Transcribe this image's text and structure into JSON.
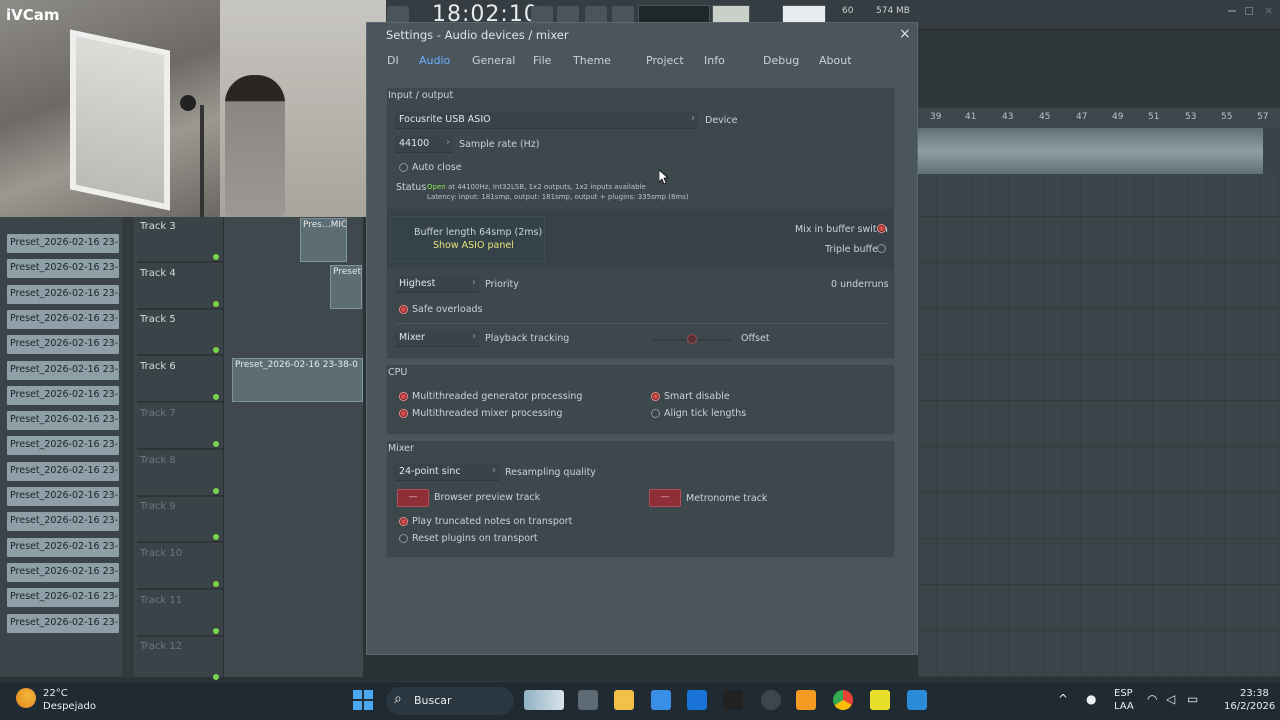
{
  "topbar": {
    "time": "18:02:10",
    "tempo_readout": "60",
    "memory": "574 MB"
  },
  "camera": {
    "label": "iVCam"
  },
  "playlist_left": {
    "presets": [
      "Preset_2026-02-16 23-21...",
      "Preset_2026-02-16 23-22...",
      "Preset_2026-02-16 23-22...",
      "Preset_2026-02-16 23-22...",
      "Preset_2026-02-16 23-22...",
      "Preset_2026-02-16 23-22...",
      "Preset_2026-02-16 23-23...",
      "Preset_2026-02-16 23-23...",
      "Preset_2026-02-16 23-23...",
      "Preset_2026-02-16 23-24...",
      "Preset_2026-02-16 23-24...",
      "Preset_2026-02-16 23-24...",
      "Preset_2026-02-16 23-28...",
      "Preset_2026-02-16 23-29...",
      "Preset_2026-02-16 23-30...",
      "Preset_2026-02-16 23-30..."
    ],
    "tracks": [
      "Track 3",
      "Track 4",
      "Track 5",
      "Track 6",
      "Track 7",
      "Track 8",
      "Track 9",
      "Track 10",
      "Track 11",
      "Track 12"
    ],
    "clips": {
      "c1": "Pres...MIC",
      "c2": "Preset",
      "c3": "Preset_2026-02-16 23-38-0"
    }
  },
  "ruler": {
    "marks": [
      "39",
      "41",
      "43",
      "45",
      "47",
      "49",
      "51",
      "53",
      "55",
      "57"
    ]
  },
  "settings": {
    "title": "Settings - Audio devices / mixer",
    "close": "×",
    "tabs": [
      "DI",
      "Audio",
      "General",
      "File",
      "Theme",
      "Project",
      "Info",
      "Debug",
      "About"
    ],
    "active_tab": "Audio",
    "io": {
      "section": "Input / output",
      "device_value": "Focusrite USB ASIO",
      "device_label": "Device",
      "rate_value": "44100",
      "rate_label": "Sample rate (Hz)",
      "auto_close": "Auto close",
      "status_label": "Status",
      "status_open": "Open",
      "status_line1": "at 44100Hz, Int32LSB, 1x2 outputs, 1x2 inputs available",
      "status_line2": "Latency: input: 181smp, output: 181smp, output + plugins: 335smp (8ms)",
      "buffer_length": "Buffer length 64smp (2ms)",
      "show_asio": "Show ASIO panel",
      "mix_buffer": "Mix in buffer switch",
      "triple_buffer": "Triple buffer",
      "priority_value": "Highest",
      "priority_label": "Priority",
      "underruns": "0 underruns",
      "safe_overloads": "Safe overloads",
      "tracking_value": "Mixer",
      "tracking_label": "Playback tracking",
      "offset": "Offset"
    },
    "cpu": {
      "section": "CPU",
      "multi_gen": "Multithreaded generator processing",
      "multi_mix": "Multithreaded mixer processing",
      "smart_disable": "Smart disable",
      "align_tick": "Align tick lengths"
    },
    "mixer": {
      "section": "Mixer",
      "resample_value": "24-point sinc",
      "resample_label": "Resampling quality",
      "btn_dash": "—",
      "browser_preview": "Browser preview track",
      "metronome": "Metronome track",
      "play_truncated": "Play truncated notes on transport",
      "reset_plugins": "Reset plugins on transport"
    }
  },
  "taskbar": {
    "temp": "22°C",
    "weather": "Despejado",
    "search": "Buscar",
    "lang1": "ESP",
    "lang2": "LAA",
    "clock": "23:38",
    "date": "16/2/2026"
  },
  "colors": {
    "accent": "#6ab0ff",
    "radio_on": "#e14a4a",
    "status_open": "#8fe04f",
    "link": "#e6e37a"
  }
}
